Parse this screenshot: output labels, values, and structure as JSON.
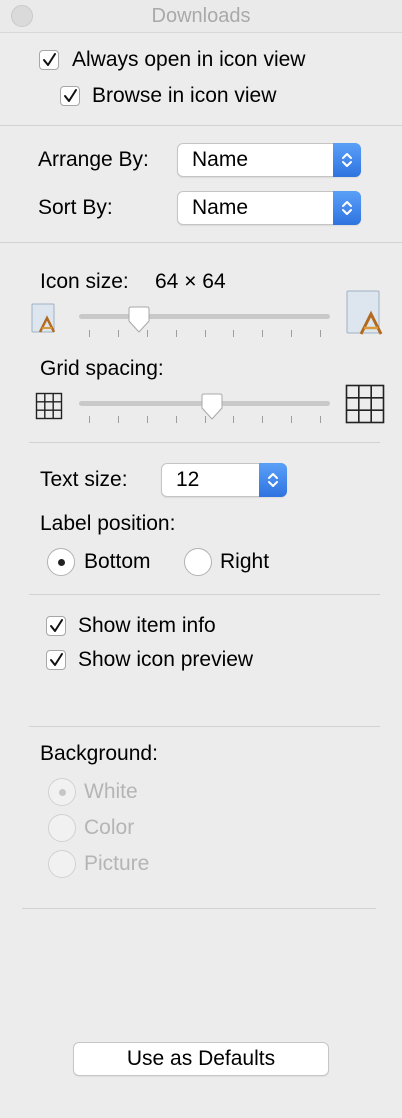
{
  "window": {
    "title": "Downloads"
  },
  "view_options": {
    "always_open_label": "Always open in icon view",
    "browse_label": "Browse in icon view",
    "always_open_checked": true,
    "browse_checked": true
  },
  "arrange": {
    "arrange_by_label": "Arrange By:",
    "arrange_by_value": "Name",
    "sort_by_label": "Sort By:",
    "sort_by_value": "Name"
  },
  "icon_size": {
    "label": "Icon size:",
    "value_text": "64 × 64",
    "slider_fraction": 0.24
  },
  "grid_spacing": {
    "label": "Grid spacing:",
    "slider_fraction": 0.53
  },
  "text": {
    "text_size_label": "Text size:",
    "text_size_value": "12",
    "label_position_label": "Label position:",
    "bottom_label": "Bottom",
    "right_label": "Right",
    "selected": "Bottom"
  },
  "info": {
    "show_item_info_label": "Show item info",
    "show_icon_preview_label": "Show icon preview",
    "show_item_info_checked": true,
    "show_icon_preview_checked": true
  },
  "background": {
    "label": "Background:",
    "options": [
      "White",
      "Color",
      "Picture"
    ],
    "selected": "White",
    "enabled": false
  },
  "defaults_button": {
    "label": "Use as Defaults"
  },
  "colors": {
    "accent": "#2f73e0",
    "disabled_text": "#b5b5b5"
  },
  "icons": [
    "checkbox-check-icon",
    "popup-stepper-icon",
    "small-app-icon",
    "large-app-icon",
    "small-grid-icon",
    "large-grid-icon",
    "slider-thumb-icon"
  ]
}
